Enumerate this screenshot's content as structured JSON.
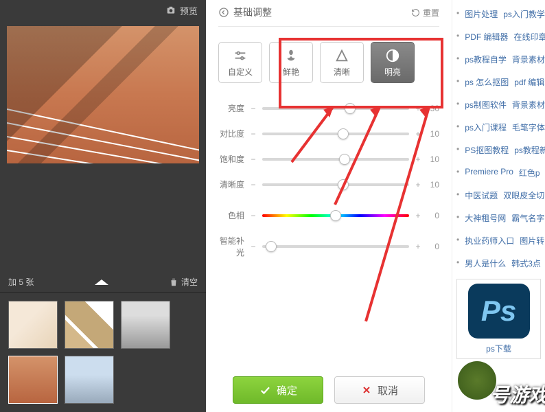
{
  "leftPanel": {
    "previewLabel": "预览",
    "toolbar": {
      "count": "加 5 张",
      "clear": "清空"
    }
  },
  "panel": {
    "title": "基础调整",
    "reset": "重置",
    "presets": {
      "custom": "自定义",
      "vivid": "鲜艳",
      "sharp": "清晰",
      "bright": "明亮"
    }
  },
  "sliders": [
    {
      "label": "亮度",
      "value": 30,
      "pos": 60
    },
    {
      "label": "对比度",
      "value": 10,
      "pos": 55
    },
    {
      "label": "饱和度",
      "value": 10,
      "pos": 56
    },
    {
      "label": "清晰度",
      "value": 10,
      "pos": 55
    },
    {
      "label": "色相",
      "value": 0,
      "pos": 50,
      "hue": true
    },
    {
      "label": "智能补光",
      "value": 0,
      "pos": 6
    }
  ],
  "buttons": {
    "ok": "确定",
    "cancel": "取消"
  },
  "sidebar": {
    "items": [
      [
        "图片处理",
        "ps入门教学"
      ],
      [
        "PDF 编辑器",
        "在线印章"
      ],
      [
        "ps教程自学",
        "背景素材"
      ],
      [
        "ps 怎么抠图",
        "pdf 编辑"
      ],
      [
        "ps制图软件",
        "背景素材"
      ],
      [
        "ps入门课程",
        "毛笔字体"
      ],
      [
        "PS抠图教程",
        "ps教程新"
      ],
      [
        "Premiere Pro",
        "红色p"
      ],
      [
        "中医试题",
        "双眼皮全切"
      ],
      [
        "大神租号网",
        "霸气名字"
      ],
      [
        "执业药师入口",
        "图片转"
      ],
      [
        "男人是什么",
        "韩式3点"
      ]
    ],
    "psCaption": "ps下载"
  },
  "watermark": "号游戏"
}
